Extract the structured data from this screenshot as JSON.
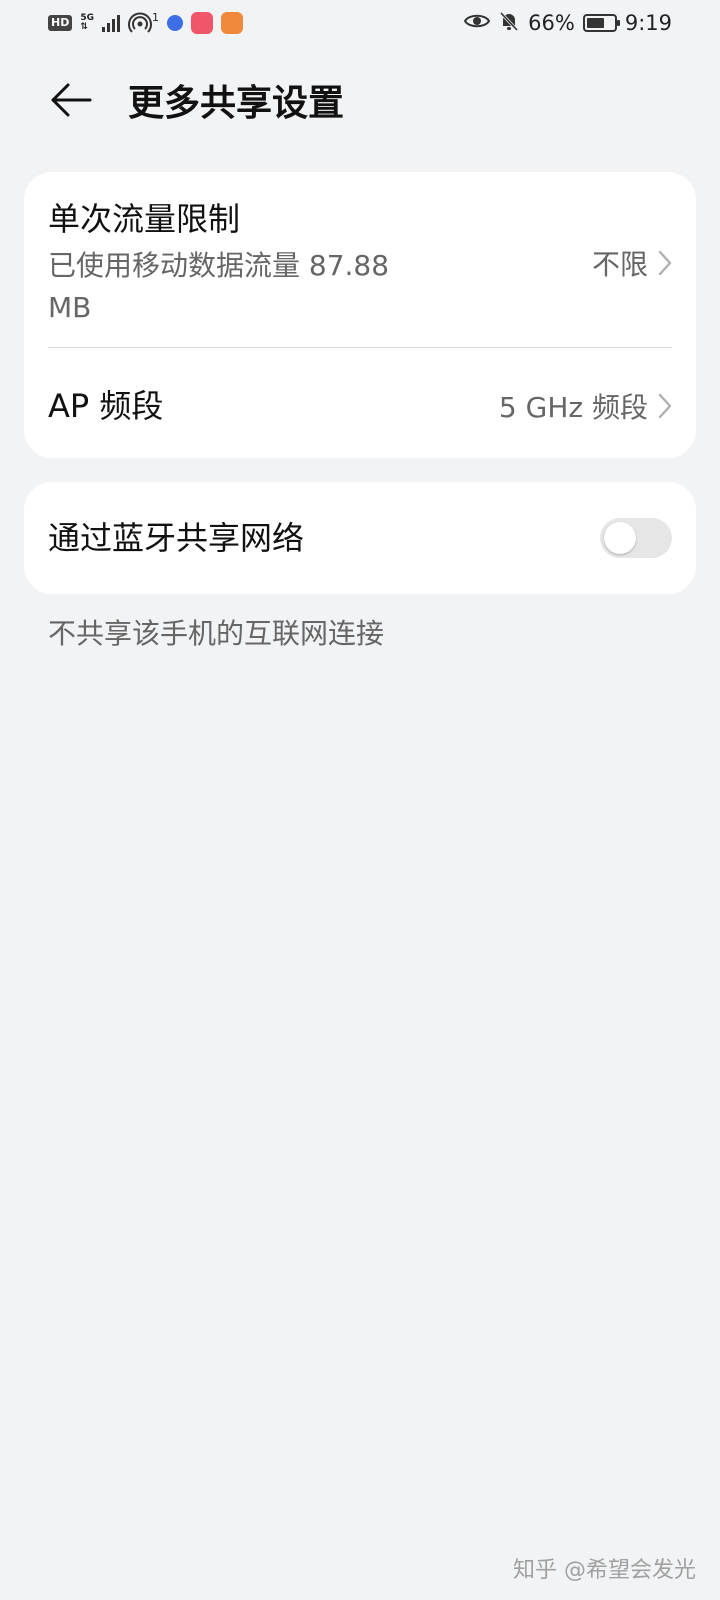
{
  "status_bar": {
    "hd_badge": "HD",
    "network_label": "5G",
    "hotspot_count": "1",
    "battery_percent": "66%",
    "battery_level": 0.66,
    "time": "9:19",
    "icons": [
      "hd-icon",
      "signal-icon",
      "hotspot-icon",
      "music-app-icon",
      "shop-app-icon",
      "health-app-icon",
      "eye-icon",
      "bell-muted-icon",
      "battery-icon"
    ],
    "colors": {
      "shop_app": "#f0566a",
      "health_app": "#f08a3a",
      "music_app": "#3d6ee8"
    }
  },
  "header": {
    "back_icon": "arrow-left-icon",
    "title": "更多共享设置"
  },
  "settings": {
    "data_limit": {
      "title": "单次流量限制",
      "subtitle": "已使用移动数据流量 87.88 MB",
      "value": "不限"
    },
    "ap_band": {
      "title": "AP 频段",
      "value": "5 GHz 频段"
    },
    "bluetooth_share": {
      "title": "通过蓝牙共享网络",
      "enabled": false
    }
  },
  "description": "不共享该手机的互联网连接",
  "watermark": "知乎 @希望会发光"
}
